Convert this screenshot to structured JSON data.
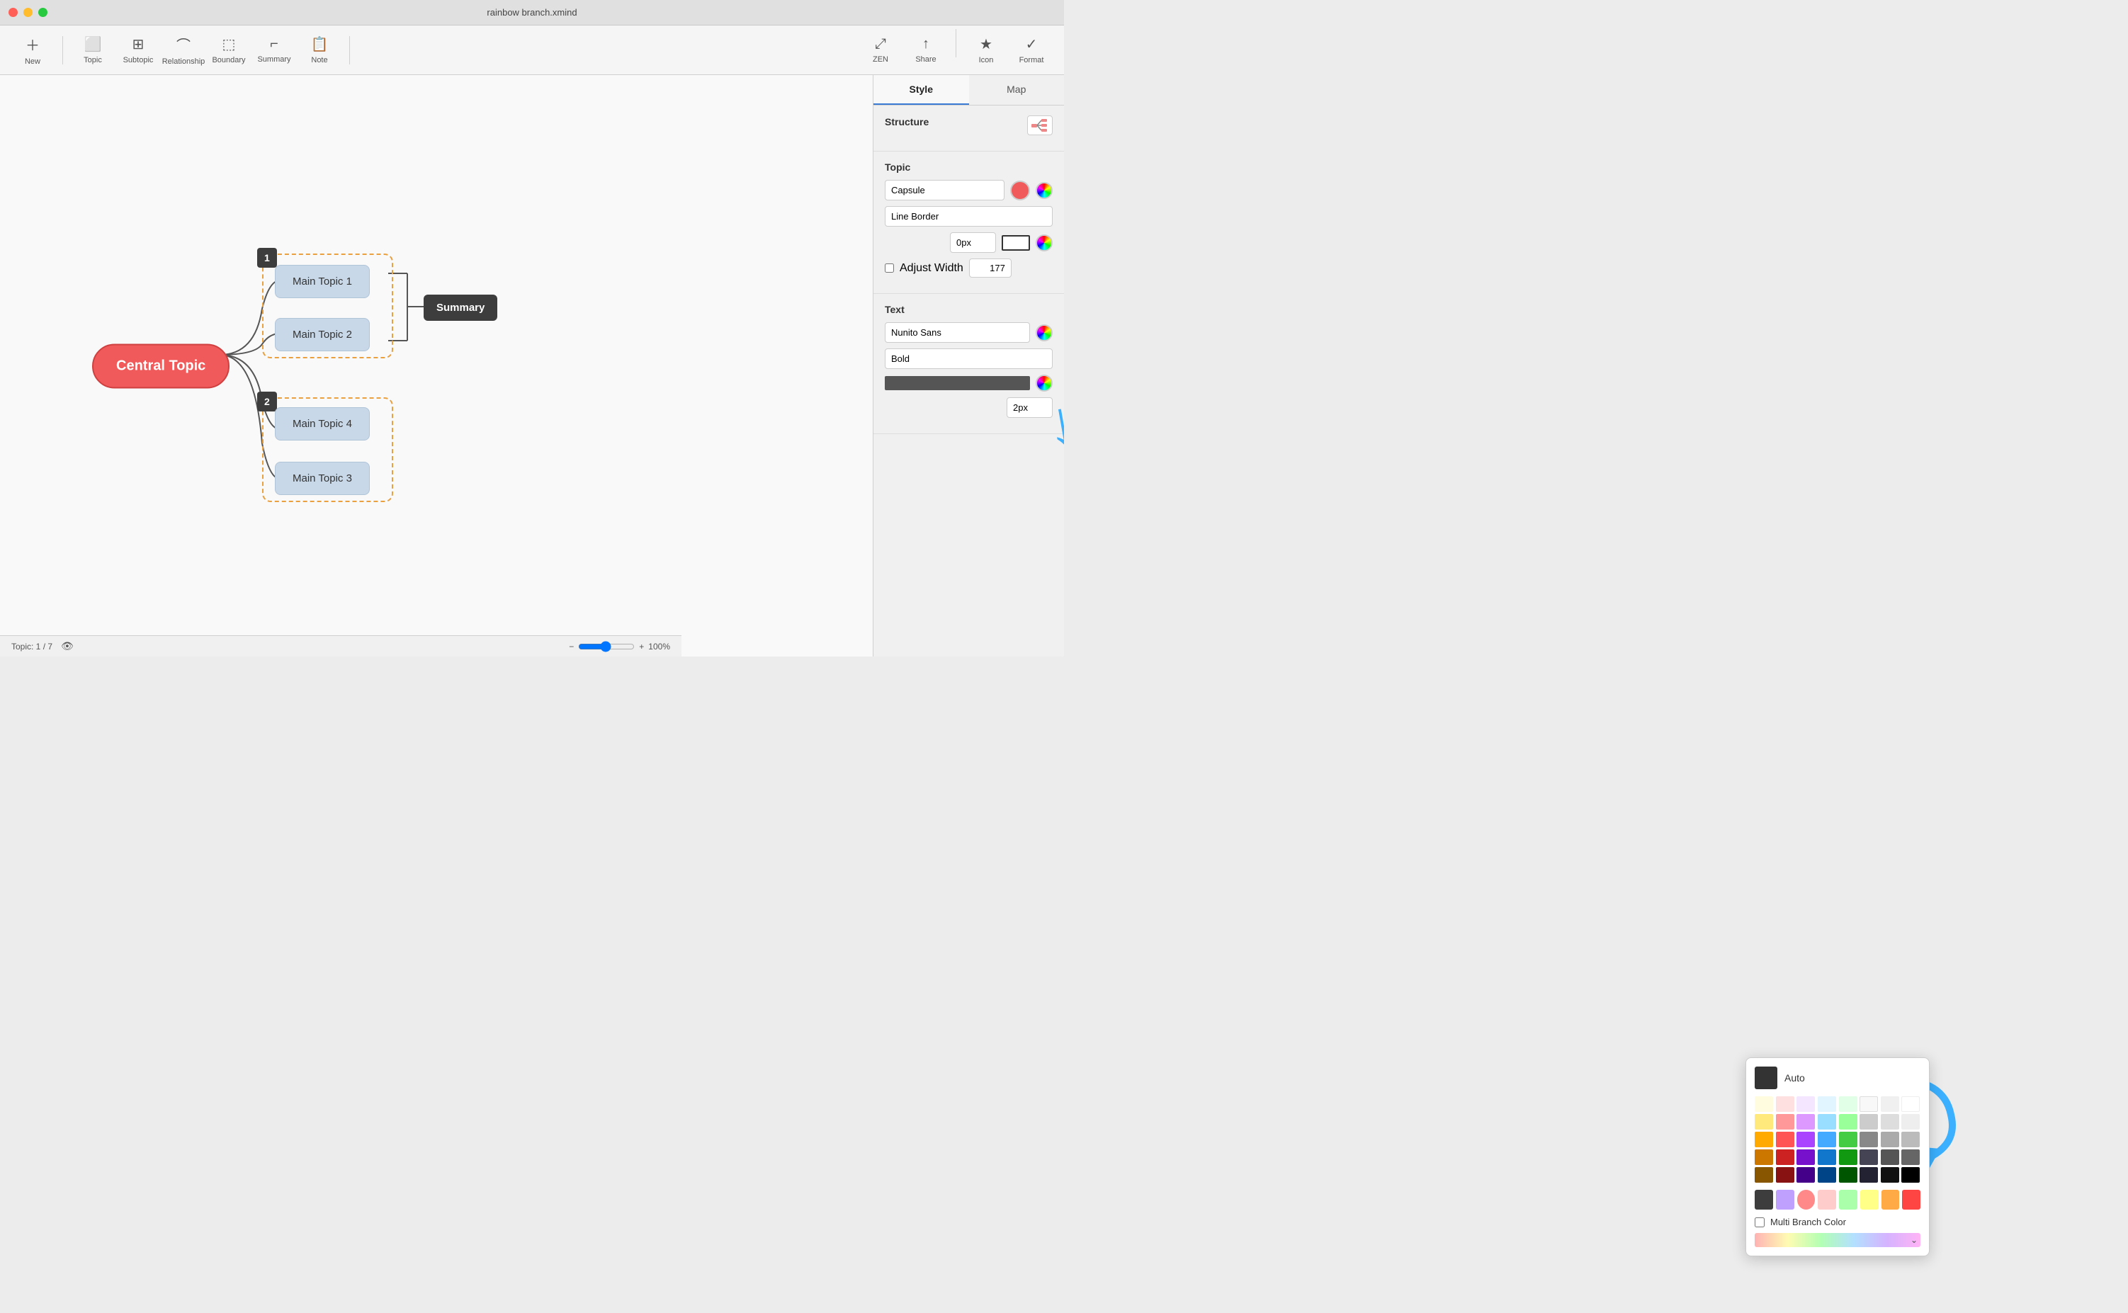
{
  "titlebar": {
    "title": "rainbow branch.xmind"
  },
  "toolbar": {
    "new_label": "New",
    "topic_label": "Topic",
    "subtopic_label": "Subtopic",
    "relationship_label": "Relationship",
    "boundary_label": "Boundary",
    "summary_label": "Summary",
    "note_label": "Note",
    "zen_label": "ZEN",
    "share_label": "Share",
    "icon_label": "Icon",
    "format_label": "Format"
  },
  "panel": {
    "style_tab": "Style",
    "map_tab": "Map",
    "structure_label": "Structure",
    "topic_label": "Topic",
    "text_label": "Text",
    "shape_label": "Capsule",
    "line_border_label": "Line Border",
    "border_size_label": "0px",
    "adjust_width_label": "Adjust Width",
    "adjust_width_value": "177",
    "font_label": "Nunito Sans",
    "font_weight_label": "Bold",
    "line_size_label": "2px"
  },
  "mindmap": {
    "central_topic": "Central Topic",
    "main_topic_1": "Main Topic 1",
    "main_topic_2": "Main Topic 2",
    "main_topic_3": "Main Topic 3",
    "main_topic_4": "Main Topic 4",
    "summary_label": "Summary",
    "boundary_1": "1",
    "boundary_2": "2"
  },
  "statusbar": {
    "topic_count": "Topic: 1 / 7",
    "zoom": "100%"
  },
  "color_picker": {
    "auto_label": "Auto",
    "multi_branch_label": "Multi Branch Color",
    "colors_row1": [
      "#fffff0",
      "#fff0f0",
      "#f5e6ff",
      "#e0f5ff",
      "#e0ffe0",
      "#ffffff"
    ],
    "colors_row2": [
      "#ffe87c",
      "#ff9999",
      "#dd99ff",
      "#99ddff",
      "#99ff99",
      "#dddddd"
    ],
    "colors_row3": [
      "#ffaa00",
      "#ff5555",
      "#aa44ff",
      "#44aaff",
      "#44cc44",
      "#aaaaaa"
    ],
    "colors_row4": [
      "#cc7700",
      "#cc2222",
      "#7711cc",
      "#1177cc",
      "#119911",
      "#555555"
    ],
    "colors_row5": [
      "#885500",
      "#881111",
      "#440088",
      "#004488",
      "#005500",
      "#111111"
    ],
    "bottom_colors": [
      "#3d3d3d",
      "#c0a0ff",
      "#ff8888",
      "#ffcccc",
      "#aaffaa",
      "#ffff88",
      "#ffaa44",
      "#ff4444"
    ]
  }
}
